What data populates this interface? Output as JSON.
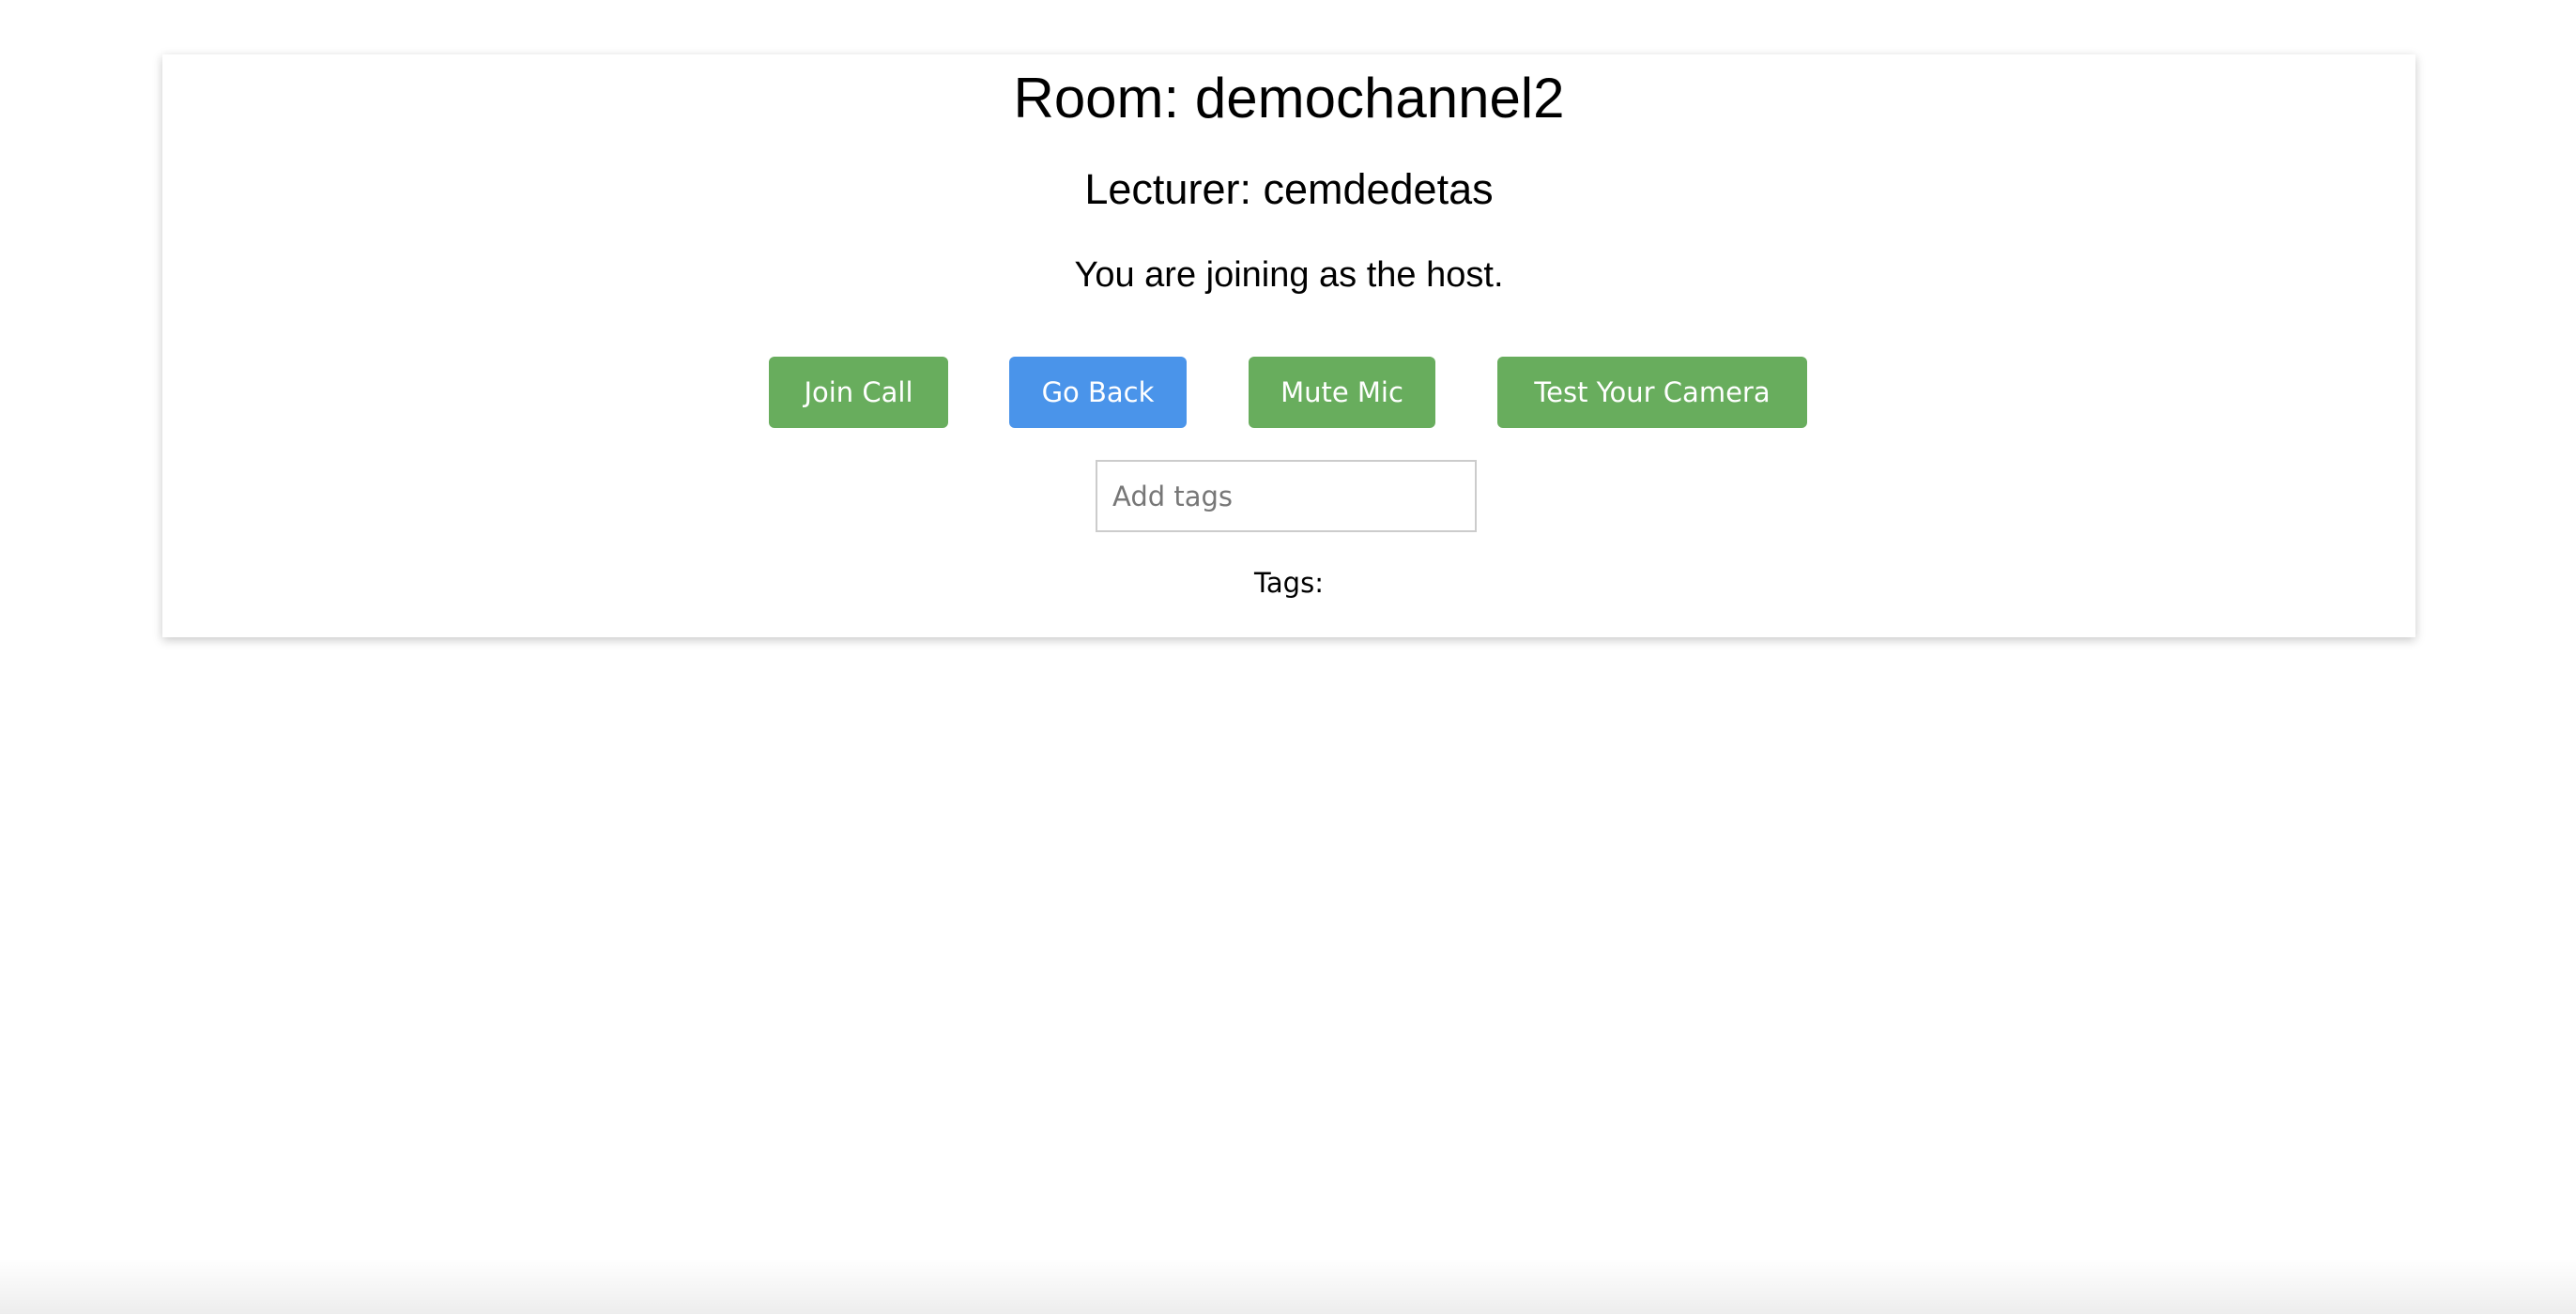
{
  "room": {
    "title": "Room: demochannel2"
  },
  "lecturer": {
    "text": "Lecturer: cemdedetas"
  },
  "role": {
    "text": "You are joining as the host."
  },
  "buttons": {
    "join_call": "Join Call",
    "go_back": "Go Back",
    "mute_mic": "Mute Mic",
    "test_camera": "Test Your Camera"
  },
  "tags": {
    "placeholder": "Add tags",
    "value": "",
    "label": "Tags:"
  },
  "colors": {
    "green": "#68ad5d",
    "blue": "#4a94ea"
  }
}
